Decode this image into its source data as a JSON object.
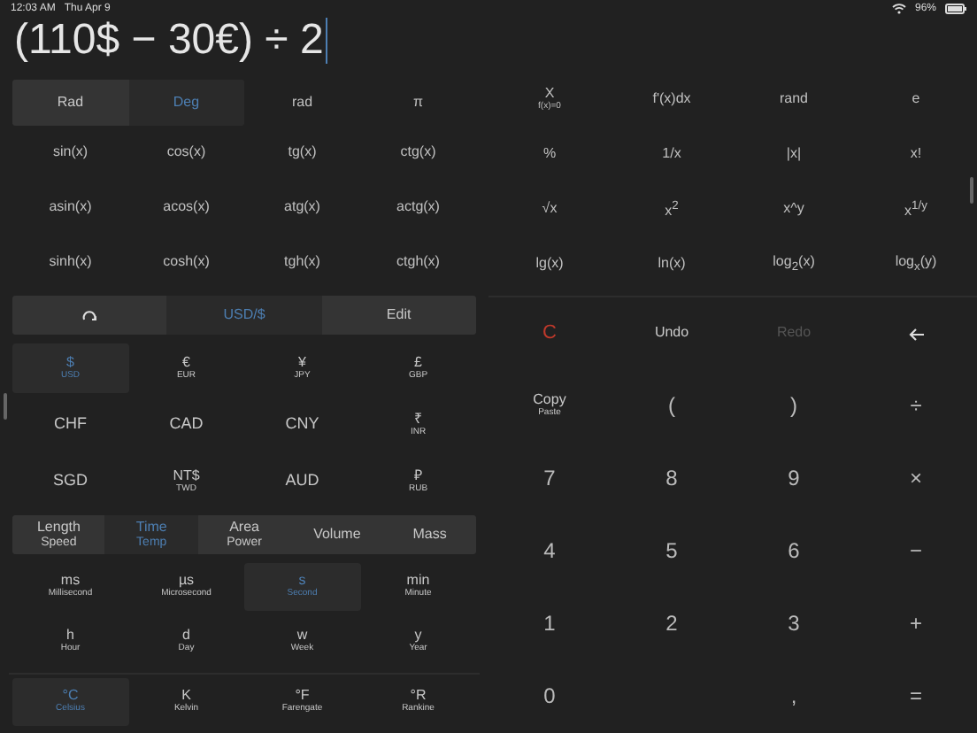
{
  "status_bar": {
    "time": "12:03 AM",
    "date": "Thu Apr 9",
    "battery": "96%"
  },
  "expression": "(110$ − 30€) ÷ 2",
  "angle_modes": [
    {
      "label": "Rad",
      "selected": false
    },
    {
      "label": "Deg",
      "selected": true
    }
  ],
  "angle_keys": [
    "rad",
    "π"
  ],
  "left_functions": [
    "sin(x)",
    "cos(x)",
    "tg(x)",
    "ctg(x)",
    "asin(x)",
    "acos(x)",
    "atg(x)",
    "actg(x)",
    "sinh(x)",
    "cosh(x)",
    "tgh(x)",
    "ctgh(x)"
  ],
  "right_functions": [
    {
      "label": "X",
      "sub": "f(x)=0"
    },
    {
      "label": "f'(x)dx"
    },
    {
      "label": "rand"
    },
    {
      "label": "e"
    },
    {
      "label": "%"
    },
    {
      "label": "1/x"
    },
    {
      "label": "|x|"
    },
    {
      "label": "x!"
    },
    {
      "label": "√x"
    },
    {
      "label": "x$^{2}$"
    },
    {
      "label": "x^y"
    },
    {
      "label": "x$^{1/y}$"
    },
    {
      "label": "lg(x)"
    },
    {
      "label": "ln(x)"
    },
    {
      "label": "log$_{2}$(x)"
    },
    {
      "label": "log$_{x}$(y)"
    }
  ],
  "converter_bar": {
    "pair": "USD/$",
    "edit": "Edit"
  },
  "currencies": [
    {
      "symbol": "$",
      "name": "USD",
      "selected": true
    },
    {
      "symbol": "€",
      "name": "EUR",
      "selected": false
    },
    {
      "symbol": "¥",
      "name": "JPY",
      "selected": false
    },
    {
      "symbol": "£",
      "name": "GBP",
      "selected": false
    },
    {
      "symbol": "CHF",
      "selected": false
    },
    {
      "symbol": "CAD",
      "selected": false
    },
    {
      "symbol": "CNY",
      "selected": false
    },
    {
      "symbol": "₹",
      "name": "INR",
      "selected": false
    },
    {
      "symbol": "SGD",
      "selected": false
    },
    {
      "symbol": "NT$",
      "name": "TWD",
      "selected": false
    },
    {
      "symbol": "AUD",
      "selected": false
    },
    {
      "symbol": "₽",
      "name": "RUB",
      "selected": false
    }
  ],
  "unit_categories": [
    {
      "label": "Length",
      "sub": "Speed",
      "selected": false
    },
    {
      "label": "Time",
      "sub": "Temp",
      "selected": true
    },
    {
      "label": "Area",
      "sub": "Power",
      "selected": false
    },
    {
      "label": "Volume",
      "selected": false
    },
    {
      "label": "Mass",
      "selected": false
    }
  ],
  "time_units": [
    {
      "symbol": "ms",
      "name": "Millisecond",
      "selected": false
    },
    {
      "symbol": "µs",
      "name": "Microsecond",
      "selected": false
    },
    {
      "symbol": "s",
      "name": "Second",
      "selected": true
    },
    {
      "symbol": "min",
      "name": "Minute",
      "selected": false
    },
    {
      "symbol": "h",
      "name": "Hour",
      "selected": false
    },
    {
      "symbol": "d",
      "name": "Day",
      "selected": false
    },
    {
      "symbol": "w",
      "name": "Week",
      "selected": false
    },
    {
      "symbol": "y",
      "name": "Year",
      "selected": false
    }
  ],
  "temp_units": [
    {
      "symbol": "°C",
      "name": "Celsius",
      "selected": true
    },
    {
      "symbol": "K",
      "name": "Kelvin",
      "selected": false
    },
    {
      "symbol": "°F",
      "name": "Farengate",
      "selected": false
    },
    {
      "symbol": "°R",
      "name": "Rankine",
      "selected": false
    }
  ],
  "keypad": [
    {
      "kind": "clear",
      "label": "C"
    },
    {
      "kind": "undo",
      "label": "Undo"
    },
    {
      "kind": "redo",
      "label": "Redo",
      "disabled": true
    },
    {
      "kind": "backspace"
    },
    {
      "kind": "copy",
      "label": "Copy",
      "sub": "Paste"
    },
    {
      "kind": "key",
      "label": "("
    },
    {
      "kind": "key",
      "label": ")"
    },
    {
      "kind": "op",
      "label": "÷"
    },
    {
      "kind": "key",
      "label": "7"
    },
    {
      "kind": "key",
      "label": "8"
    },
    {
      "kind": "key",
      "label": "9"
    },
    {
      "kind": "op",
      "label": "×"
    },
    {
      "kind": "key",
      "label": "4"
    },
    {
      "kind": "key",
      "label": "5"
    },
    {
      "kind": "key",
      "label": "6"
    },
    {
      "kind": "op",
      "label": "−"
    },
    {
      "kind": "key",
      "label": "1"
    },
    {
      "kind": "key",
      "label": "2"
    },
    {
      "kind": "key",
      "label": "3"
    },
    {
      "kind": "op",
      "label": "+"
    },
    {
      "kind": "key",
      "label": "0"
    },
    {
      "kind": "blank"
    },
    {
      "kind": "key",
      "label": ","
    },
    {
      "kind": "op",
      "label": "="
    }
  ]
}
